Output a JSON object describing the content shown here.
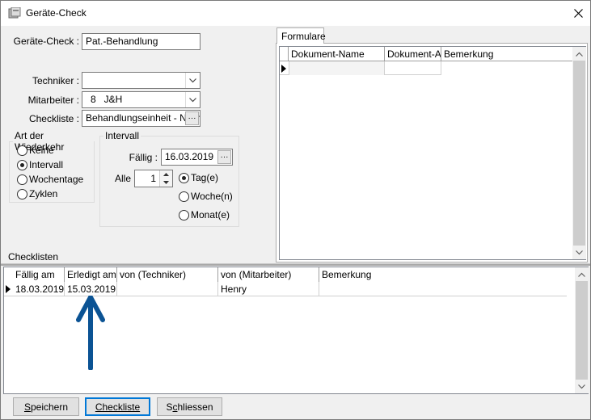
{
  "window": {
    "title": "Geräte-Check"
  },
  "form": {
    "geraete_check_label": "Geräte-Check :",
    "geraete_check_value": "Pat.-Behandlung",
    "techniker_label": "Techniker :",
    "techniker_value": "",
    "mitarbeiter_label": "Mitarbeiter :",
    "mitarbeiter_value": "8   J&H",
    "checkliste_label": "Checkliste :",
    "checkliste_value": "Behandlungseinheit - Nach",
    "dots": "···"
  },
  "art_der_wiederkehr": {
    "legend": "Art der Wiederkehr",
    "options": [
      {
        "label": "Keine",
        "checked": false
      },
      {
        "label": "Intervall",
        "checked": true
      },
      {
        "label": "Wochentage",
        "checked": false
      },
      {
        "label": "Zyklen",
        "checked": false
      }
    ]
  },
  "intervall": {
    "legend": "Intervall",
    "faellig_label": "Fällig :",
    "faellig_value": "16.03.2019",
    "alle_label": "Alle",
    "alle_value": "1",
    "units": [
      {
        "label": "Tag(e)",
        "checked": true
      },
      {
        "label": "Woche(n)",
        "checked": false
      },
      {
        "label": "Monat(e)",
        "checked": false
      }
    ]
  },
  "checklisten_label": "Checklisten",
  "formulare": {
    "tab_label": "Formulare",
    "columns": [
      "Dokument-Name",
      "Dokument-Art",
      "Bemerkung"
    ]
  },
  "checklist_table": {
    "columns": [
      "Fällig am",
      "Erledigt am",
      "von (Techniker)",
      "von (Mitarbeiter)",
      "Bemerkung"
    ],
    "rows": [
      {
        "faellig": "18.03.2019",
        "erledigt": "15.03.2019",
        "techniker": "",
        "mitarbeiter": "Henry",
        "bemerkung": ""
      }
    ]
  },
  "buttons": {
    "speichern": {
      "mnemonic": "S",
      "rest": "peichern"
    },
    "checkliste": {
      "mnemonic": "C",
      "rest": "heckliste"
    },
    "schliessen": {
      "first": "S",
      "mnemonic": "c",
      "rest": "hliessen"
    }
  },
  "colors": {
    "arrow": "#0b5394",
    "accent": "#0078d7"
  }
}
